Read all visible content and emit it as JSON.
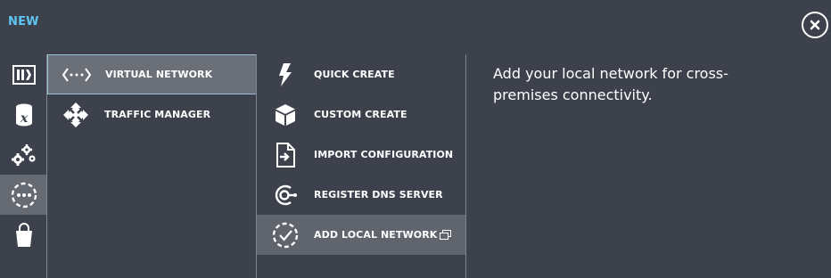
{
  "header": {
    "title": "NEW"
  },
  "rail": {
    "items": [
      "compute-icon",
      "data-services-icon",
      "app-services-icon",
      "network-services-icon",
      "store-icon"
    ],
    "active_index": 3
  },
  "services": [
    {
      "label": "VIRTUAL NETWORK",
      "icon": "virtual-network-icon",
      "selected": true
    },
    {
      "label": "TRAFFIC MANAGER",
      "icon": "traffic-manager-icon",
      "selected": false
    }
  ],
  "actions": [
    {
      "label": "QUICK CREATE",
      "icon": "lightning-icon"
    },
    {
      "label": "CUSTOM CREATE",
      "icon": "cube-icon"
    },
    {
      "label": "IMPORT CONFIGURATION",
      "icon": "import-file-icon"
    },
    {
      "label": "REGISTER DNS SERVER",
      "icon": "dns-server-icon"
    },
    {
      "label": "ADD LOCAL NETWORK",
      "icon": "local-network-icon",
      "selected": true
    }
  ],
  "description": "Add your local network for cross-premises connectivity.",
  "colors": {
    "background": "#3c414c",
    "accent": "#5ec6f1",
    "selected": "#6a6f78"
  }
}
